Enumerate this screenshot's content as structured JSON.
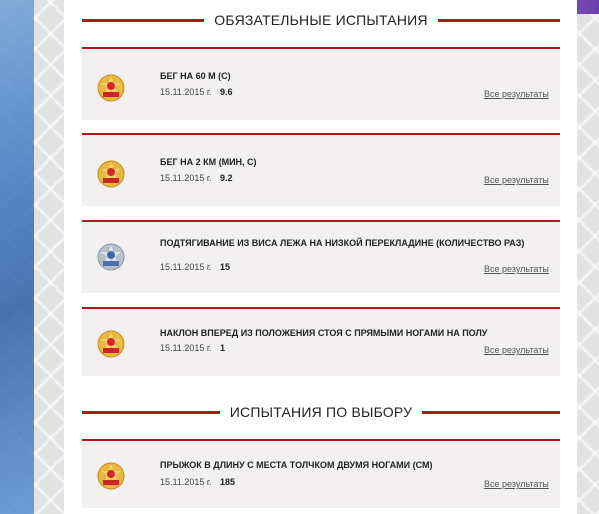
{
  "colors": {
    "accent": "#b01818",
    "card_bg": "#f2f0f0",
    "badge_gold": "#e0a826",
    "badge_silver": "#a9b4c0"
  },
  "sections": [
    {
      "title": "ОБЯЗАТЕЛЬНЫЕ ИСПЫТАНИЯ"
    },
    {
      "title": "ИСПЫТАНИЯ ПО ВЫБОРУ"
    }
  ],
  "tests": [
    {
      "title": "БЕГ НА 60 М  (С)",
      "date": "15.11.2015 г.",
      "value": "9.6",
      "link": "Все результаты",
      "badge": "gold-badge-icon"
    },
    {
      "title": "БЕГ НА 2 КМ (МИН, С)",
      "date": "15.11.2015 г.",
      "value": "9.2",
      "link": "Все результаты",
      "badge": "gold-badge-icon"
    },
    {
      "title": "ПОДТЯГИВАНИЕ ИЗ ВИСА ЛЕЖА НА НИЗКОЙ ПЕРЕКЛАДИНЕ (КОЛИЧЕСТВО РАЗ)",
      "date": "15.11.2015 г.",
      "value": "15",
      "link": "Все результаты",
      "badge": "silver-badge-icon"
    },
    {
      "title": "НАКЛОН ВПЕРЕД ИЗ ПОЛОЖЕНИЯ СТОЯ С ПРЯМЫМИ НОГАМИ НА ПОЛУ",
      "date": "15.11.2015 г.",
      "value": "1",
      "link": "Все результаты",
      "badge": "gold-badge-icon"
    },
    {
      "title": "ПРЫЖОК В ДЛИНУ С МЕСТА ТОЛЧКОМ ДВУМЯ НОГАМИ (СМ)",
      "date": "15.11.2015 г.",
      "value": "185",
      "link": "Все результаты",
      "badge": "gold-badge-icon"
    }
  ]
}
